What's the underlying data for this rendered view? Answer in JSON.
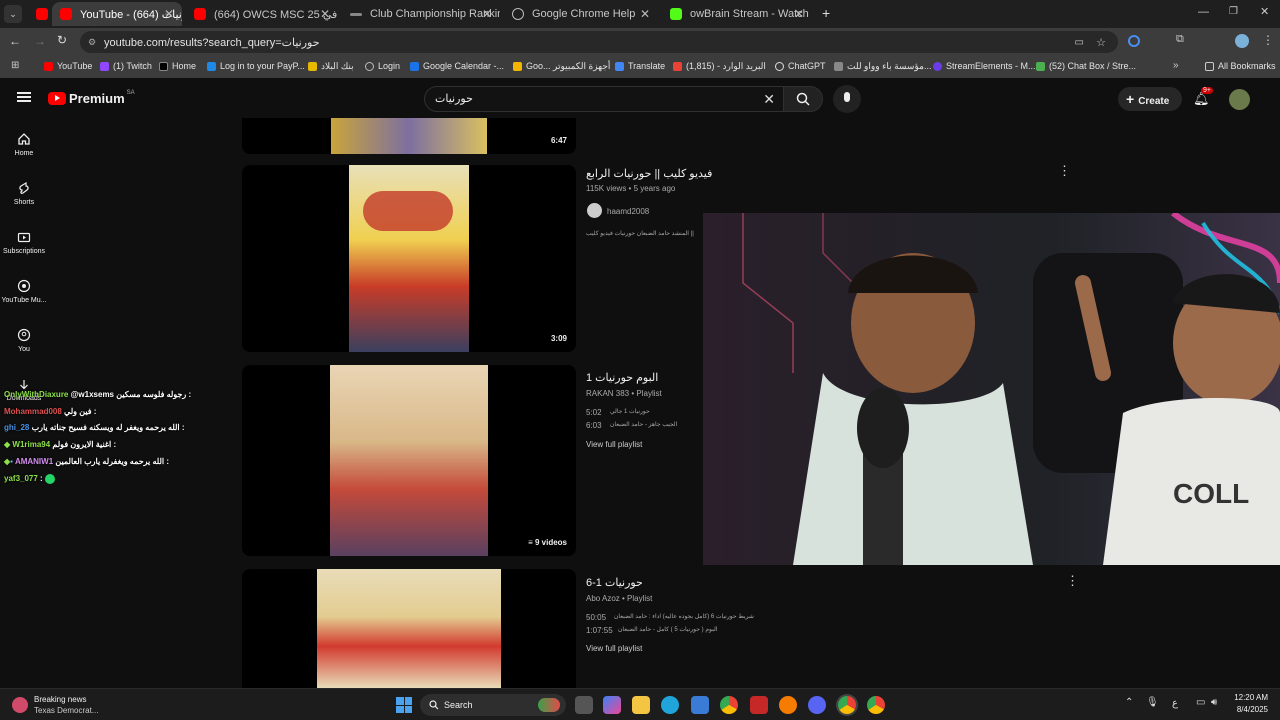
{
  "browser": {
    "tabs": [
      {
        "label": "YouTube - حورنيات (664)",
        "active": true
      },
      {
        "label": "(664) OWCS MSC بطولة في 25"
      },
      {
        "label": "Club Championship Ranking"
      },
      {
        "label": "Google Chrome Help"
      },
      {
        "label": "owBrain Stream - Watch Li"
      }
    ],
    "new_tab": "+",
    "url": "youtube.com/results?search_query=حورنيات",
    "bookmarks": [
      "YouTube",
      "(1) Twitch",
      "Home",
      "Log in to your PayP...",
      "بنك البلاد",
      "Login",
      "Google Calendar -...",
      "Goo... أجهزة الكمبيوتر",
      "Translate",
      "البريد الوارد - (1,815)",
      "ChatGPT",
      "مؤسسة باء وواو للت...",
      "StreamElements - M...",
      "(52) Chat Box / Stre..."
    ],
    "all_bookmarks": "All Bookmarks"
  },
  "youtube": {
    "logo": "Premium",
    "region": "SA",
    "search_value": "حورنيات",
    "create_label": "Create",
    "notif_count": "9+"
  },
  "sidebar": [
    {
      "label": "Home",
      "icon": "home-icon"
    },
    {
      "label": "Shorts",
      "icon": "shorts-icon"
    },
    {
      "label": "Subscriptions",
      "icon": "subscriptions-icon"
    },
    {
      "label": "YouTube Mu...",
      "icon": "youtube-music-icon"
    },
    {
      "label": "You",
      "icon": "you-icon"
    },
    {
      "label": "Downloads",
      "icon": "downloads-icon"
    }
  ],
  "results": [
    {
      "duration": "6:47"
    },
    {
      "title": "فيديو كليب || حورنيات الرابع",
      "meta": "115K views • 5 years ago",
      "channel": "haamd2008",
      "desc": "المنشد حامد الضبعان حورنيات فيديو كليب ||",
      "duration": "3:09"
    },
    {
      "title": "البوم حورنيات 1",
      "meta": "RAKAN 383 • Playlist",
      "items": [
        {
          "time": "5:02",
          "text": "حورنيات 1 جالي"
        },
        {
          "time": "6:03",
          "text": "الجيب جاهز - حامد الضبعان"
        }
      ],
      "view_full": "View full playlist",
      "videos_badge": "9 videos"
    },
    {
      "title": "حورنيات 1-6",
      "meta": "Abo Azoz • Playlist",
      "items": [
        {
          "time": "50:05",
          "text": "شريط حورنيات 6 (كامل بجوده عاليه) اداء : حامد الضبعان"
        },
        {
          "time": "1:07:55",
          "text": "البوم ( حورنيات 5 ) كامل - حامد الضبعان"
        }
      ],
      "view_full": "View full playlist"
    }
  ],
  "chat": [
    {
      "user": "OnlyWithDiaxure",
      "msg": "@w1xsems رجوله فلوسه مسكين :",
      "color": "#8ee04a"
    },
    {
      "user": "Mohammad008",
      "msg": "فين ولي :",
      "color": "#e05050"
    },
    {
      "user": "ghi_28",
      "msg": "الله يرحمه ويغفر له ويسكنه فسيح جناته يارب :",
      "color": "#4a90e2"
    },
    {
      "user": "W1rima94",
      "msg": "اغنية الايرون فولم :",
      "color": "#8ee04a"
    },
    {
      "user": "AMANIW1",
      "msg": "الله يرحمه ويغفرله يارب العالمين :",
      "color": "#d48ef0"
    },
    {
      "user": "yaf3_077",
      "msg": ":",
      "color": "#8ee04a"
    }
  ],
  "taskbar": {
    "news_title": "Breaking news",
    "news_sub": "Texas Democrat...",
    "search_label": "Search",
    "lang": "ع",
    "time": "12:20 AM",
    "date": "8/4/2025"
  }
}
